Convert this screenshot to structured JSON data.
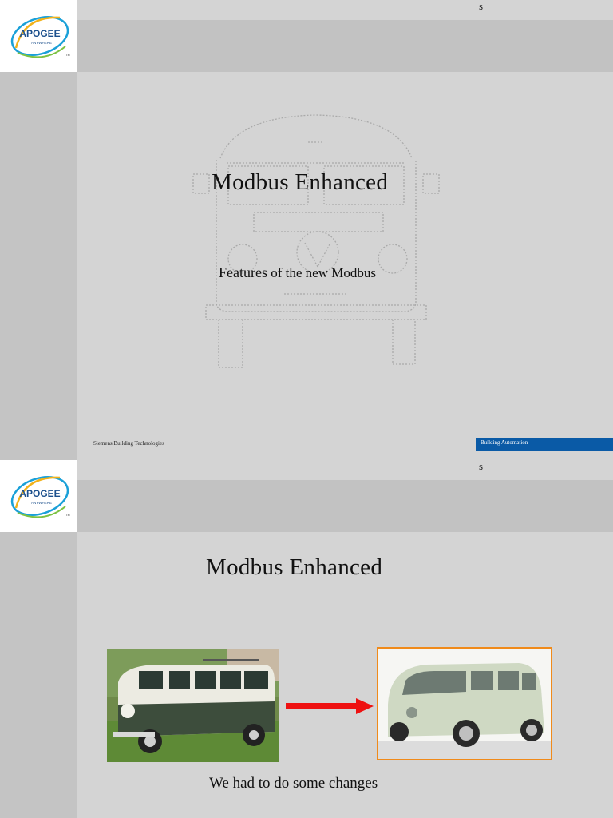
{
  "slides": [
    {
      "corner_letter": "s",
      "title": "Modbus Enhanced",
      "subtitle_first": "Features",
      "subtitle_rest": " of the new Modbus",
      "footer_left": "Siemens Building Technologies",
      "footer_right": "Building Automation"
    },
    {
      "corner_letter": "s",
      "title": "Modbus Enhanced",
      "caption": "We had to do some changes"
    }
  ],
  "logo": {
    "brand": "APOGEE",
    "tagline": "ANYWHERE",
    "trademark": "TM"
  },
  "colors": {
    "footer_band": "#0a5aa6",
    "arrow": "#ee1111",
    "photo_border": "#f08a1a"
  }
}
